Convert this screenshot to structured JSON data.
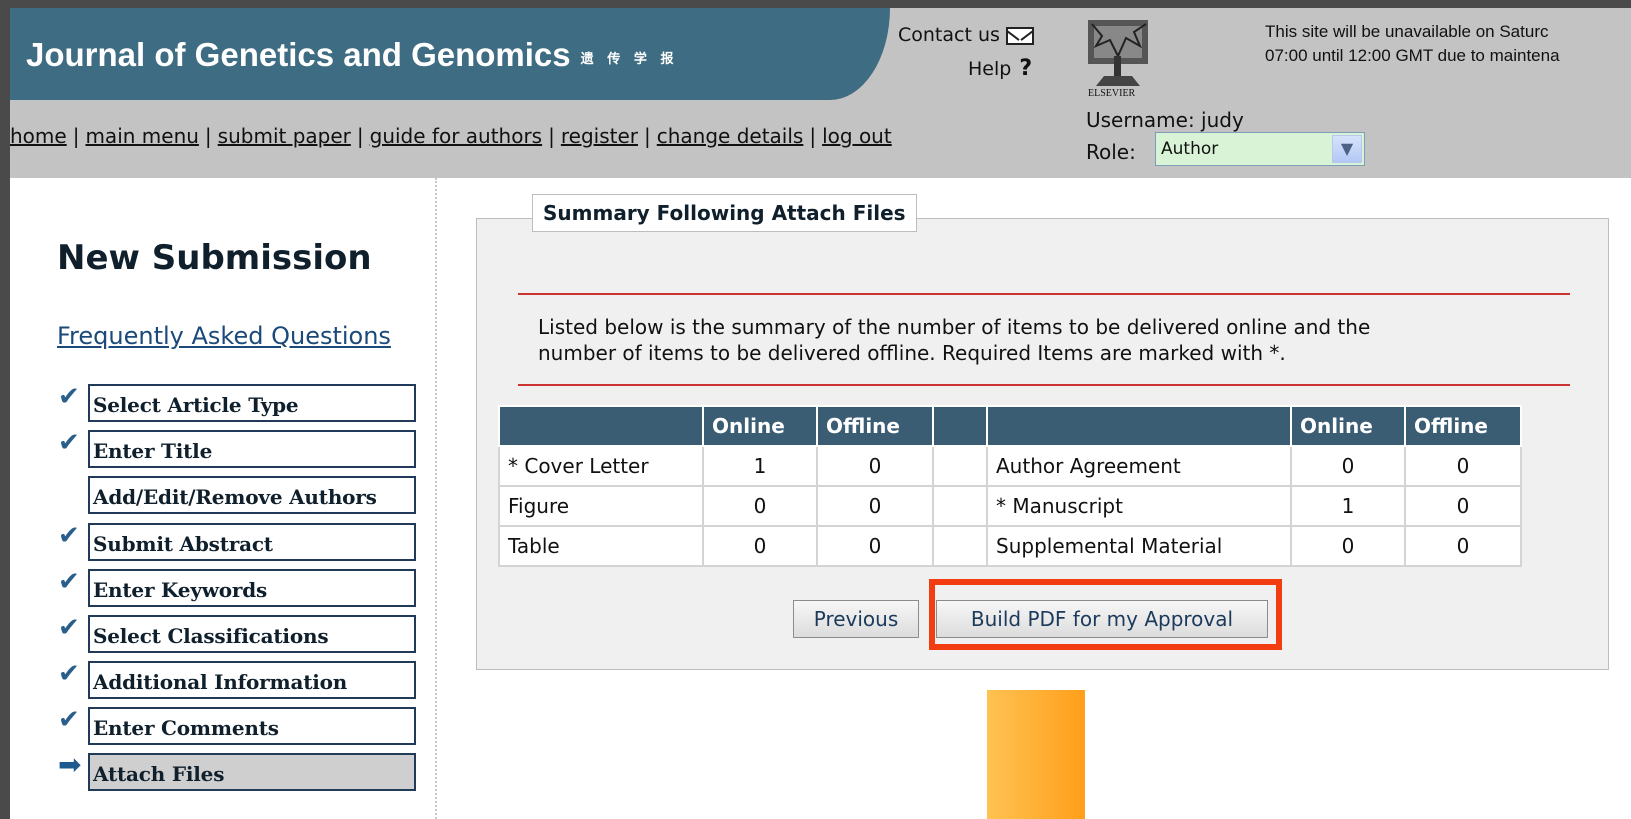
{
  "header": {
    "title": "Journal of Genetics and Genomics",
    "title_cn": "遗 传 学 报",
    "contact_label": "Contact us",
    "help_label": "Help",
    "help_icon_glyph": "?",
    "publisher_label": "ELSEVIER",
    "notice_line1": "This site will be unavailable on Saturc",
    "notice_line2": "07:00 until 12:00 GMT due to maintena",
    "username_text": "Username: judy",
    "role_label": "Role:",
    "role_value": "Author"
  },
  "nav": {
    "items": [
      "home",
      "main menu",
      "submit paper",
      "guide for authors",
      "register",
      "change details",
      "log out"
    ]
  },
  "sidebar": {
    "heading": "New Submission",
    "faq_link": "Frequently Asked Questions",
    "steps": [
      {
        "label": "Select Article Type",
        "status": "complete"
      },
      {
        "label": "Enter Title",
        "status": "complete"
      },
      {
        "label": "Add/Edit/Remove Authors",
        "status": "pending"
      },
      {
        "label": "Submit Abstract",
        "status": "complete"
      },
      {
        "label": "Enter Keywords",
        "status": "complete"
      },
      {
        "label": "Select Classifications",
        "status": "complete"
      },
      {
        "label": "Additional Information",
        "status": "complete"
      },
      {
        "label": "Enter Comments",
        "status": "complete"
      },
      {
        "label": "Attach Files",
        "status": "current"
      }
    ]
  },
  "main": {
    "legend": "Summary Following Attach Files",
    "intro_line1": "Listed below is the summary of the number of items to be delivered online and the",
    "intro_line2": "number of items to be delivered offline. Required Items are marked with *.",
    "table": {
      "headers": [
        "",
        "Online",
        "Offline",
        "",
        "",
        "Online",
        "Offline"
      ],
      "rows": [
        {
          "left_item": "* Cover Letter",
          "left_required": true,
          "left_online": "1",
          "left_offline": "0",
          "right_item": "Author Agreement",
          "right_required": false,
          "right_online": "0",
          "right_offline": "0"
        },
        {
          "left_item": "Figure",
          "left_required": false,
          "left_online": "0",
          "left_offline": "0",
          "right_item": "* Manuscript",
          "right_required": true,
          "right_online": "1",
          "right_offline": "0"
        },
        {
          "left_item": "Table",
          "left_required": false,
          "left_online": "0",
          "left_offline": "0",
          "right_item": "Supplemental Material",
          "right_required": false,
          "right_online": "0",
          "right_offline": "0"
        }
      ]
    },
    "previous_button": "Previous",
    "build_pdf_button": "Build PDF for my Approval"
  },
  "colors": {
    "title_band": "#3e6c82",
    "header_bg": "#c3c3c3",
    "table_header": "#3b5d74",
    "required_text": "#b0141b",
    "highlight_box": "#f23c11",
    "divider": "#cc3333"
  },
  "icons": {
    "contact": "mail-icon",
    "help": "question-icon",
    "step_complete": "checkmark-icon",
    "step_current": "arrow-right-icon",
    "dropdown": "chevron-down-icon"
  }
}
